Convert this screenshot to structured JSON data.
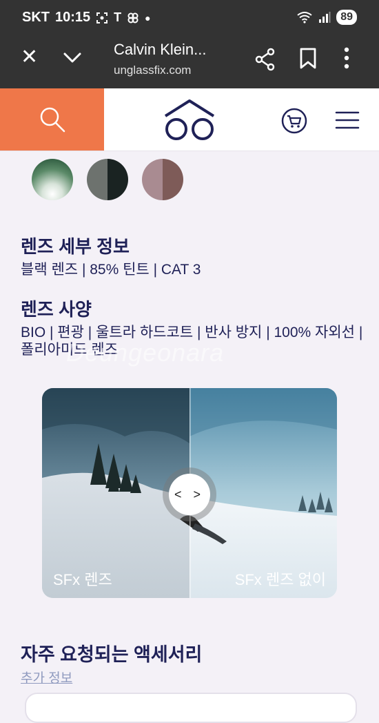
{
  "status_bar": {
    "carrier": "SKT",
    "time": "10:15",
    "battery": "89",
    "icons": [
      "screenshot-icon",
      "t-icon",
      "pinwheel-icon",
      "dot-icon",
      "wifi-icon",
      "signal-icon"
    ]
  },
  "browser": {
    "title": "Calvin Klein...",
    "url": "unglassfix.com"
  },
  "nav": {
    "search_color": "#ef7749",
    "brand_color": "#1f2157"
  },
  "swatches": [
    "green-gradient",
    "grey-black",
    "rose-brown"
  ],
  "lens_details": {
    "title": "렌즈 세부 정보",
    "text": "블랙 렌즈 | 85% 틴트 | CAT 3"
  },
  "lens_specs": {
    "title": "렌즈 사양",
    "text": "BIO | 편광 | 울트라 하드코트 | 반사 방지 | 100% 자외선 | 폴리아미드 렌즈"
  },
  "watermark": "Deungeonara",
  "compare": {
    "left_label": "SFx 렌즈",
    "right_label": "SFx 렌즈 없이",
    "handle": "< >"
  },
  "faq": {
    "title": "자주 요청되는 액세서리",
    "link": "추가 정보"
  }
}
